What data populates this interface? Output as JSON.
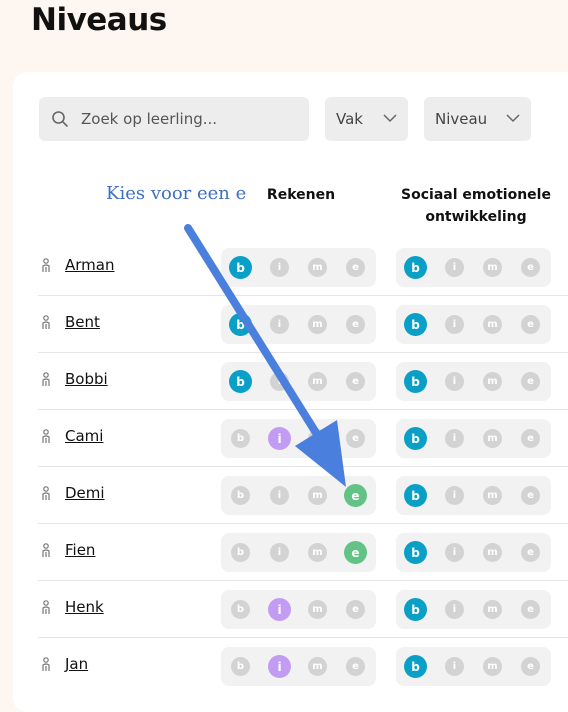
{
  "page": {
    "title": "Niveaus"
  },
  "toolbar": {
    "search_placeholder": "Zoek op leerling...",
    "subject_filter_label": "Vak",
    "level_filter_label": "Niveau"
  },
  "annotation": {
    "text": "Kies voor een e"
  },
  "columns": [
    {
      "line1": "Rekenen",
      "line2": ""
    },
    {
      "line1": "Sociaal emotionele",
      "line2": "ontwikkeling"
    }
  ],
  "level_letters": [
    "b",
    "i",
    "m",
    "e"
  ],
  "colors": {
    "b": "#0a9fc7",
    "i": "#c29cf2",
    "m": "#d3d3d3",
    "e": "#63c285",
    "inactive": "#d3d3d3",
    "annotation": "#3e6fc4"
  },
  "students": [
    {
      "name": "Arman",
      "rekenen": "b",
      "sociaal": "b"
    },
    {
      "name": "Bent",
      "rekenen": "b",
      "sociaal": "b"
    },
    {
      "name": "Bobbi",
      "rekenen": "b",
      "sociaal": "b"
    },
    {
      "name": "Cami",
      "rekenen": "i",
      "sociaal": "b"
    },
    {
      "name": "Demi",
      "rekenen": "e",
      "sociaal": "b"
    },
    {
      "name": "Fien",
      "rekenen": "e",
      "sociaal": "b"
    },
    {
      "name": "Henk",
      "rekenen": "i",
      "sociaal": "b"
    },
    {
      "name": "Jan",
      "rekenen": "i",
      "sociaal": "b"
    }
  ],
  "icons": {
    "search": "magnifier-icon",
    "dropdown": "chevron-down-icon",
    "student": "person-icon",
    "annotation_arrow": "arrow-icon"
  }
}
